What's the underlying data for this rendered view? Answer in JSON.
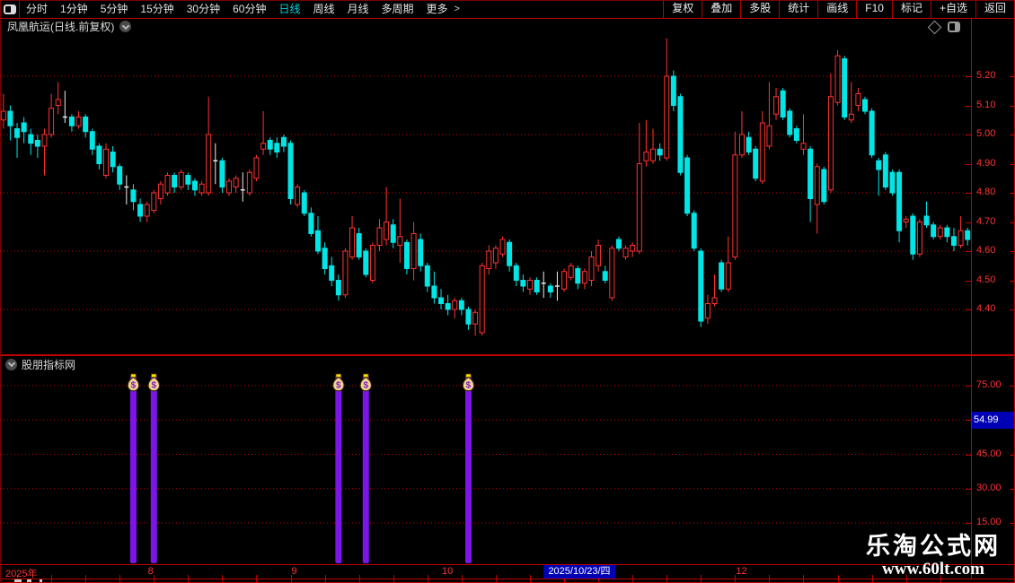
{
  "menu": {
    "left_items": [
      {
        "label": "分时",
        "active": false
      },
      {
        "label": "1分钟",
        "active": false
      },
      {
        "label": "5分钟",
        "active": false
      },
      {
        "label": "15分钟",
        "active": false
      },
      {
        "label": "30分钟",
        "active": false
      },
      {
        "label": "60分钟",
        "active": false
      },
      {
        "label": "日线",
        "active": true
      },
      {
        "label": "周线",
        "active": false
      },
      {
        "label": "月线",
        "active": false
      },
      {
        "label": "多周期",
        "active": false
      },
      {
        "label": "更多",
        "active": false
      }
    ],
    "more_arrow": ">",
    "right_items": [
      "复权",
      "叠加",
      "多股",
      "统计",
      "画线",
      "F10",
      "标记",
      "+自选",
      "返回"
    ]
  },
  "chart": {
    "title": "凤凰航运(日线.前复权)",
    "up_color": "#ff3232",
    "down_color": "#00e6e6",
    "doji_color": "#f0f0f0",
    "price_axis": {
      "labels": [
        "5.20",
        "5.10",
        "5.00",
        "4.90",
        "4.80",
        "4.70",
        "4.60",
        "4.50",
        "4.40"
      ],
      "gridlines": [
        5.2,
        5.0,
        4.8,
        4.6,
        4.4
      ]
    },
    "candles": [
      [
        5.05,
        5.14,
        5.02,
        5.08
      ],
      [
        5.08,
        5.1,
        4.98,
        5.03
      ],
      [
        5.02,
        5.04,
        4.92,
        4.99
      ],
      [
        5.04,
        5.06,
        4.97,
        5.01
      ],
      [
        5.0,
        5.02,
        4.93,
        4.97
      ],
      [
        4.98,
        5.0,
        4.92,
        4.96
      ],
      [
        4.96,
        5.02,
        4.86,
        5.0
      ],
      [
        5.0,
        5.14,
        4.99,
        5.09
      ],
      [
        5.1,
        5.18,
        5.07,
        5.12
      ],
      [
        5.06,
        5.15,
        5.04,
        5.06
      ],
      [
        5.06,
        5.07,
        5.01,
        5.03
      ],
      [
        5.03,
        5.08,
        5.02,
        5.06
      ],
      [
        5.06,
        5.07,
        4.99,
        5.01
      ],
      [
        5.01,
        5.02,
        4.93,
        4.95
      ],
      [
        4.96,
        4.97,
        4.88,
        4.9
      ],
      [
        4.86,
        4.97,
        4.85,
        4.95
      ],
      [
        4.94,
        4.96,
        4.87,
        4.89
      ],
      [
        4.89,
        4.9,
        4.81,
        4.83
      ],
      [
        4.82,
        4.86,
        4.76,
        4.82
      ],
      [
        4.81,
        4.83,
        4.74,
        4.77
      ],
      [
        4.76,
        4.78,
        4.7,
        4.72
      ],
      [
        4.72,
        4.77,
        4.7,
        4.76
      ],
      [
        4.74,
        4.81,
        4.73,
        4.8
      ],
      [
        4.78,
        4.84,
        4.76,
        4.83
      ],
      [
        4.8,
        4.87,
        4.79,
        4.86
      ],
      [
        4.86,
        4.87,
        4.8,
        4.82
      ],
      [
        4.82,
        4.88,
        4.81,
        4.87
      ],
      [
        4.86,
        4.87,
        4.81,
        4.83
      ],
      [
        4.84,
        4.85,
        4.79,
        4.81
      ],
      [
        4.8,
        4.84,
        4.79,
        4.83
      ],
      [
        4.8,
        5.13,
        4.79,
        5.0
      ],
      [
        4.91,
        4.97,
        4.83,
        4.91
      ],
      [
        4.91,
        4.92,
        4.8,
        4.82
      ],
      [
        4.8,
        4.85,
        4.79,
        4.84
      ],
      [
        4.82,
        4.86,
        4.8,
        4.85
      ],
      [
        4.81,
        4.87,
        4.77,
        4.81
      ],
      [
        4.8,
        4.88,
        4.79,
        4.87
      ],
      [
        4.85,
        4.93,
        4.84,
        4.92
      ],
      [
        4.95,
        5.08,
        4.93,
        4.97
      ],
      [
        4.98,
        4.99,
        4.93,
        4.95
      ],
      [
        4.97,
        4.99,
        4.92,
        4.94
      ],
      [
        4.99,
        5.0,
        4.94,
        4.96
      ],
      [
        4.97,
        4.98,
        4.76,
        4.78
      ],
      [
        4.76,
        4.83,
        4.75,
        4.82
      ],
      [
        4.8,
        4.81,
        4.72,
        4.73
      ],
      [
        4.73,
        4.75,
        4.65,
        4.66
      ],
      [
        4.67,
        4.72,
        4.59,
        4.6
      ],
      [
        4.61,
        4.63,
        4.52,
        4.54
      ],
      [
        4.55,
        4.58,
        4.48,
        4.5
      ],
      [
        4.5,
        4.52,
        4.43,
        4.45
      ],
      [
        4.45,
        4.61,
        4.44,
        4.6
      ],
      [
        4.58,
        4.72,
        4.57,
        4.68
      ],
      [
        4.66,
        4.68,
        4.57,
        4.58
      ],
      [
        4.6,
        4.61,
        4.51,
        4.52
      ],
      [
        4.5,
        4.63,
        4.49,
        4.62
      ],
      [
        4.62,
        4.71,
        4.6,
        4.68
      ],
      [
        4.64,
        4.82,
        4.62,
        4.7
      ],
      [
        4.69,
        4.71,
        4.61,
        4.63
      ],
      [
        4.62,
        4.78,
        4.56,
        4.65
      ],
      [
        4.63,
        4.64,
        4.52,
        4.54
      ],
      [
        4.54,
        4.7,
        4.5,
        4.66
      ],
      [
        4.64,
        4.66,
        4.53,
        4.55
      ],
      [
        4.55,
        4.56,
        4.46,
        4.48
      ],
      [
        4.48,
        4.53,
        4.42,
        4.44
      ],
      [
        4.44,
        4.47,
        4.4,
        4.42
      ],
      [
        4.42,
        4.45,
        4.38,
        4.4
      ],
      [
        4.4,
        4.44,
        4.37,
        4.43
      ],
      [
        4.43,
        4.44,
        4.38,
        4.4
      ],
      [
        4.4,
        4.41,
        4.33,
        4.35
      ],
      [
        4.35,
        4.4,
        4.31,
        4.39
      ],
      [
        4.32,
        4.56,
        4.31,
        4.55
      ],
      [
        4.54,
        4.62,
        4.52,
        4.6
      ],
      [
        4.56,
        4.62,
        4.54,
        4.61
      ],
      [
        4.59,
        4.65,
        4.58,
        4.64
      ],
      [
        4.63,
        4.64,
        4.53,
        4.55
      ],
      [
        4.55,
        4.56,
        4.48,
        4.5
      ],
      [
        4.5,
        4.52,
        4.46,
        4.48
      ],
      [
        4.47,
        4.51,
        4.45,
        4.5
      ],
      [
        4.5,
        4.51,
        4.45,
        4.46
      ],
      [
        4.49,
        4.53,
        4.44,
        4.49
      ],
      [
        4.48,
        4.49,
        4.44,
        4.46
      ],
      [
        4.48,
        4.53,
        4.43,
        4.48
      ],
      [
        4.47,
        4.54,
        4.46,
        4.53
      ],
      [
        4.51,
        4.56,
        4.5,
        4.55
      ],
      [
        4.54,
        4.55,
        4.47,
        4.49
      ],
      [
        4.49,
        4.54,
        4.47,
        4.53
      ],
      [
        4.5,
        4.6,
        4.48,
        4.58
      ],
      [
        4.55,
        4.64,
        4.53,
        4.62
      ],
      [
        4.53,
        4.55,
        4.49,
        4.5
      ],
      [
        4.44,
        4.62,
        4.43,
        4.61
      ],
      [
        4.64,
        4.65,
        4.6,
        4.61
      ],
      [
        4.58,
        4.62,
        4.57,
        4.61
      ],
      [
        4.6,
        4.63,
        4.58,
        4.62
      ],
      [
        4.6,
        5.04,
        4.59,
        4.9
      ],
      [
        4.91,
        5.05,
        4.89,
        4.94
      ],
      [
        4.91,
        5.02,
        4.9,
        4.95
      ],
      [
        4.95,
        4.97,
        4.91,
        4.93
      ],
      [
        4.92,
        5.33,
        4.91,
        5.2
      ],
      [
        5.2,
        5.22,
        5.08,
        5.1
      ],
      [
        5.13,
        5.14,
        4.86,
        4.87
      ],
      [
        4.92,
        4.93,
        4.72,
        4.73
      ],
      [
        4.73,
        4.74,
        4.6,
        4.61
      ],
      [
        4.6,
        4.61,
        4.34,
        4.36
      ],
      [
        4.37,
        4.45,
        4.35,
        4.42
      ],
      [
        4.42,
        4.52,
        4.41,
        4.44
      ],
      [
        4.56,
        4.57,
        4.46,
        4.47
      ],
      [
        4.47,
        4.65,
        4.46,
        4.56
      ],
      [
        4.58,
        5.01,
        4.57,
        4.93
      ],
      [
        4.93,
        5.08,
        4.92,
        5.0
      ],
      [
        4.99,
        5.01,
        4.93,
        4.94
      ],
      [
        4.95,
        4.96,
        4.84,
        4.85
      ],
      [
        4.84,
        5.08,
        4.83,
        5.04
      ],
      [
        4.96,
        5.18,
        4.95,
        5.03
      ],
      [
        5.07,
        5.16,
        5.05,
        5.13
      ],
      [
        5.15,
        5.16,
        5.05,
        5.06
      ],
      [
        5.08,
        5.09,
        4.99,
        5.0
      ],
      [
        5.02,
        5.03,
        4.97,
        4.98
      ],
      [
        4.95,
        5.07,
        4.93,
        4.97
      ],
      [
        4.95,
        4.96,
        4.7,
        4.78
      ],
      [
        4.76,
        4.9,
        4.66,
        4.89
      ],
      [
        4.88,
        4.89,
        4.76,
        4.77
      ],
      [
        4.81,
        5.21,
        4.8,
        5.13
      ],
      [
        5.11,
        5.29,
        5.1,
        5.27
      ],
      [
        5.26,
        5.27,
        5.05,
        5.06
      ],
      [
        5.05,
        5.18,
        5.04,
        5.07
      ],
      [
        5.1,
        5.16,
        5.08,
        5.14
      ],
      [
        5.12,
        5.13,
        5.07,
        5.08
      ],
      [
        5.08,
        5.09,
        4.92,
        4.93
      ],
      [
        4.91,
        4.92,
        4.79,
        4.88
      ],
      [
        4.93,
        4.94,
        4.81,
        4.82
      ],
      [
        4.87,
        4.88,
        4.79,
        4.8
      ],
      [
        4.87,
        4.88,
        4.63,
        4.67
      ],
      [
        4.7,
        4.72,
        4.68,
        4.71
      ],
      [
        4.72,
        4.73,
        4.57,
        4.59
      ],
      [
        4.59,
        4.71,
        4.58,
        4.7
      ],
      [
        4.72,
        4.77,
        4.68,
        4.69
      ],
      [
        4.69,
        4.7,
        4.64,
        4.65
      ],
      [
        4.65,
        4.69,
        4.64,
        4.68
      ],
      [
        4.68,
        4.69,
        4.63,
        4.65
      ],
      [
        4.65,
        4.68,
        4.6,
        4.62
      ],
      [
        4.62,
        4.72,
        4.61,
        4.67
      ],
      [
        4.67,
        4.68,
        4.62,
        4.64
      ]
    ]
  },
  "indicator": {
    "title": "股朋指标网",
    "axis_labels": [
      "75.00",
      "45.00",
      "30.00",
      "15.00"
    ],
    "gridlines": [
      75,
      60,
      45,
      30,
      15
    ],
    "current_value": "54.99",
    "bar_color": "#7c16e8",
    "signal_icon": "money-bag",
    "signals": [
      19,
      22,
      49,
      53,
      68
    ]
  },
  "time_axis": {
    "year_label": "2025年",
    "month_labels": [
      {
        "text": "8",
        "i": 21
      },
      {
        "text": "9",
        "i": 42
      },
      {
        "text": "10",
        "i": 64
      },
      {
        "text": "12",
        "i": 107
      }
    ],
    "date_box": "2025/10/23/四"
  },
  "watermark": {
    "line1": "乐淘公式网",
    "line2": "www.60lt.com"
  },
  "colors": {
    "frame_red": "#c00000",
    "label_red": "#ff3232",
    "grid_red": "#c80000",
    "active_tab": "#00d2dc",
    "highlight_blue": "#0000b4",
    "signal_purple": "#7c16e8"
  }
}
